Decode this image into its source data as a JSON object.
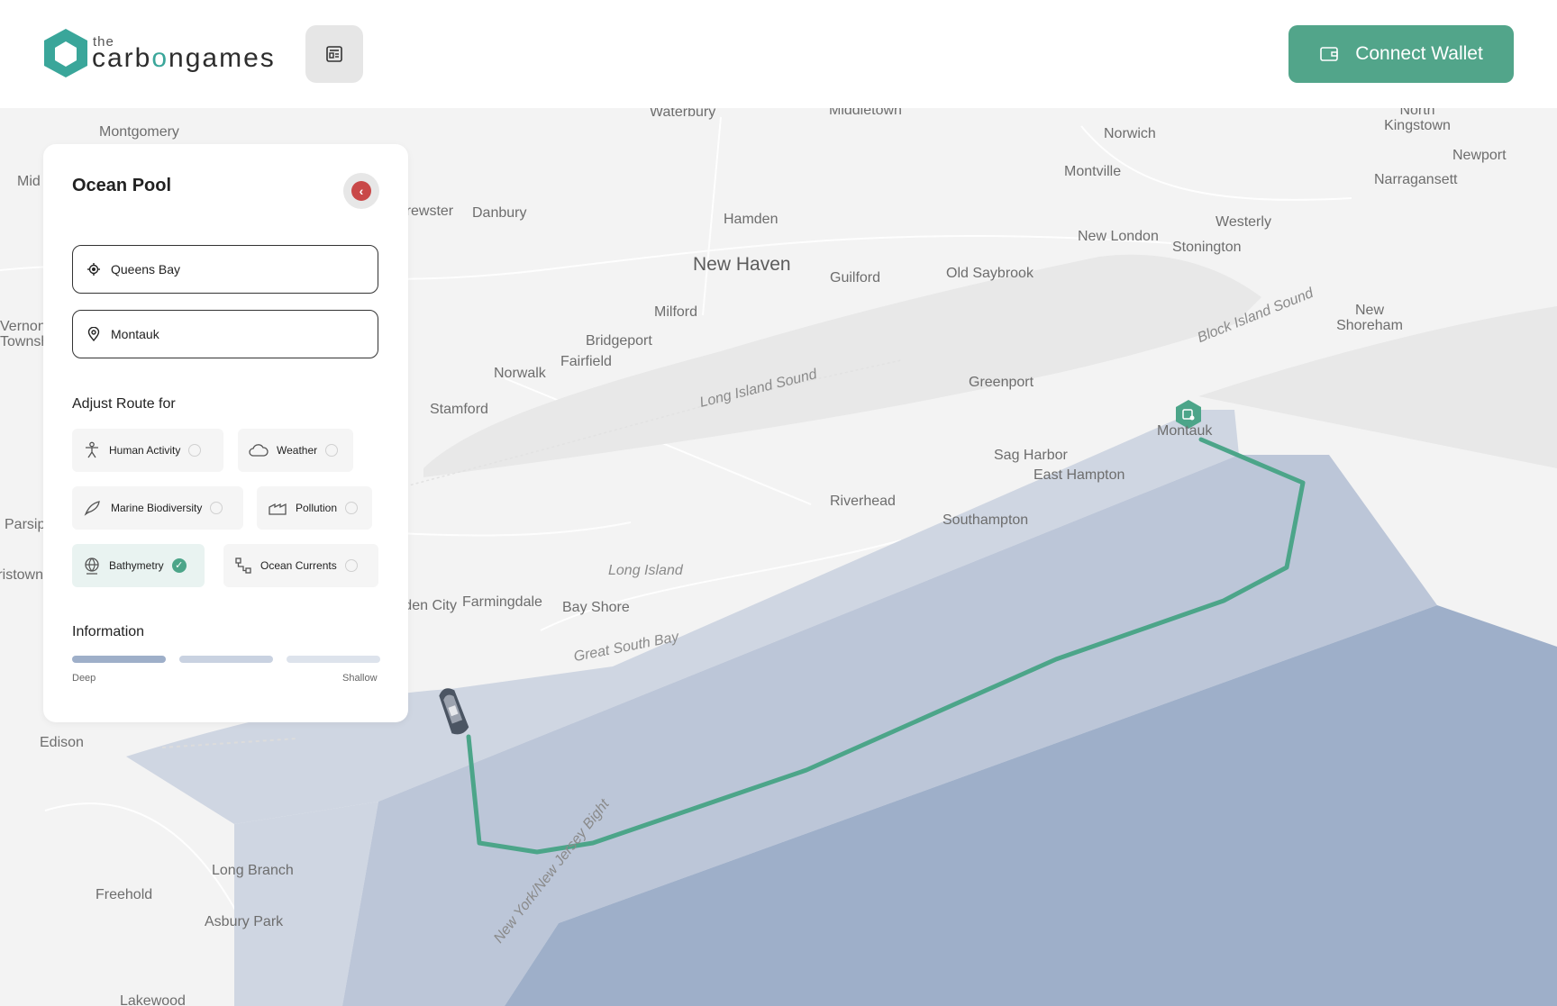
{
  "header": {
    "logo_the": "the",
    "logo_prefix": "carb",
    "logo_o": "o",
    "logo_suffix": "ngames",
    "menu_icon": "newspaper-icon",
    "wallet_label": "Connect Wallet",
    "wallet_icon": "wallet-icon"
  },
  "panel": {
    "title": "Ocean Pool",
    "collapse_icon": "chevron-left-icon",
    "origin": "Queens Bay",
    "destination": "Montauk",
    "adjust_label": "Adjust Route for",
    "options": [
      {
        "label": "Human Activity",
        "icon": "person-icon",
        "selected": false
      },
      {
        "label": "Weather",
        "icon": "cloud-icon",
        "selected": false
      },
      {
        "label": "Marine Biodiversity",
        "icon": "fish-icon",
        "selected": false
      },
      {
        "label": "Pollution",
        "icon": "factory-icon",
        "selected": false
      },
      {
        "label": "Bathymetry",
        "icon": "globe-icon",
        "selected": true
      },
      {
        "label": "Ocean Currents",
        "icon": "currents-icon",
        "selected": false
      }
    ],
    "info_label": "Information",
    "legend_deep": "Deep",
    "legend_shallow": "Shallow"
  },
  "map": {
    "places": [
      "Waterbury",
      "Middletown",
      "Norwich",
      "North Kingstown",
      "Montgomery",
      "Newport",
      "Narragansett",
      "Mid",
      "Brewster",
      "Danbury",
      "Hamden",
      "Montville",
      "Westerly",
      "New London",
      "Stonington",
      "New Haven",
      "Guilford",
      "Old Saybrook",
      "Milford",
      "Bridgeport",
      "Fairfield",
      "Norwalk",
      "Stamford",
      "New Shoreham",
      "Greenport",
      "Montauk",
      "Sag Harbor",
      "East Hampton",
      "Riverhead",
      "Southampton",
      "Long Island",
      "Garden City",
      "Farmingdale",
      "Bay Shore",
      "Vernon Township",
      "Parsippany",
      "Morristown",
      "Edison",
      "Long Branch",
      "Freehold",
      "Asbury Park",
      "Lakewood"
    ],
    "water_labels": [
      "Long Island Sound",
      "Block Island Sound",
      "Great South Bay",
      "New York/New Jersey Bight"
    ],
    "colors": {
      "route": "#4ca589",
      "deep": "#9eafc9",
      "mid": "#bcc6d8",
      "shallow": "#cfd6e2"
    }
  }
}
